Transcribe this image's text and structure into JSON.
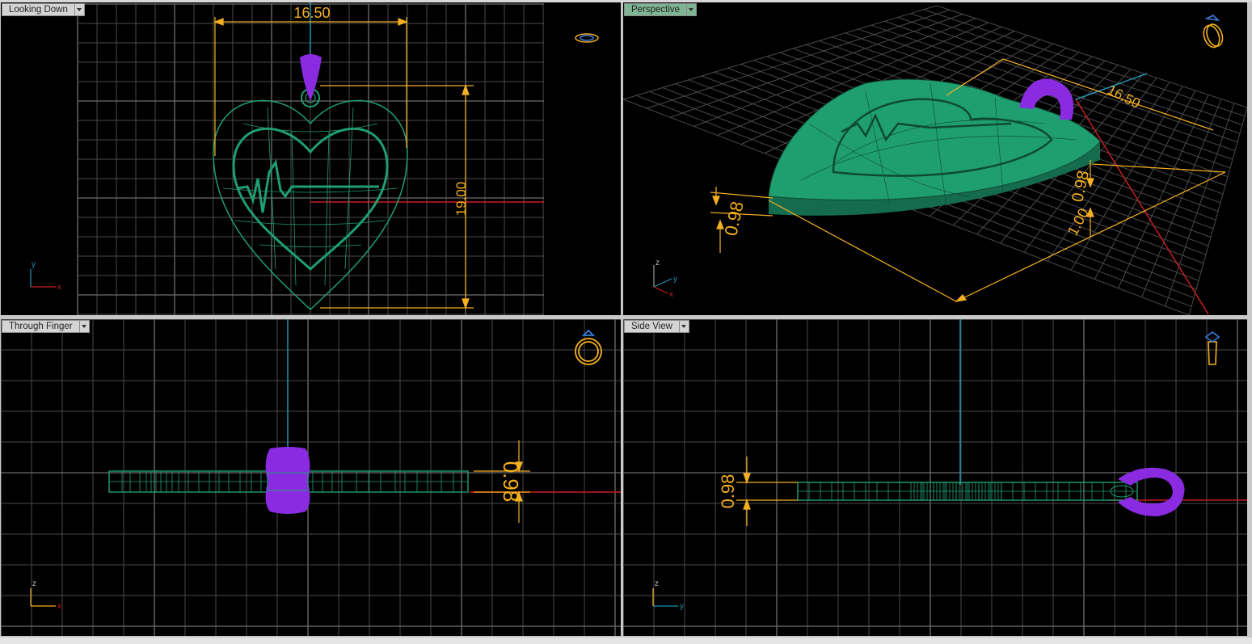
{
  "viewports": [
    {
      "id": "top",
      "label": "Looking Down",
      "active": false,
      "icon": "ring-top-view-icon"
    },
    {
      "id": "perspective",
      "label": "Perspective",
      "active": true,
      "icon": "ring-perspective-icon"
    },
    {
      "id": "front",
      "label": "Through Finger",
      "active": false,
      "icon": "ring-front-view-icon"
    },
    {
      "id": "side",
      "label": "Side View",
      "active": false,
      "icon": "ring-side-view-icon"
    }
  ],
  "dimensions": {
    "width": "16.50",
    "height": "19.00",
    "thickness": "0.98",
    "thickness_alt": "1.00"
  },
  "axes": {
    "top": {
      "h": "x",
      "v": "y"
    },
    "perspective": {
      "a": "z",
      "b": "y",
      "c": "x"
    },
    "front": {
      "h": "x",
      "v": "z"
    },
    "side": {
      "h": "y",
      "v": "z"
    }
  },
  "colors": {
    "model": "#1f9e70",
    "bail": "#8a2be2",
    "dimension": "#f5b021",
    "x_axis": "#c81e1e",
    "y_axis": "#1e96b4",
    "grid": "#4a4a4a",
    "grid_major": "#7a7a7a"
  }
}
